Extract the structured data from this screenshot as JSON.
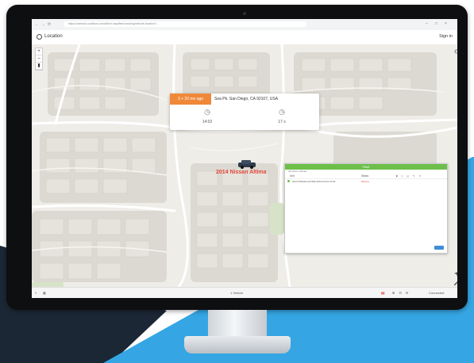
{
  "browser": {
    "back": "←",
    "forward": "→",
    "reload": "⟳",
    "url": "https://cartrack-solutions.com/#/live-map/fleet-tracking/vehicle-location?...",
    "controls": [
      "–",
      "□",
      "×"
    ]
  },
  "app": {
    "title": "Location",
    "signin": "Sign in"
  },
  "map_controls": [
    "+",
    "–",
    "▮"
  ],
  "popup": {
    "time_badge": "3 + 20 mo ago",
    "address": "Sea Pk. San Diego, CA 92107, USA",
    "stats": [
      {
        "icon": "clock-icon",
        "glyph": "◷",
        "value": "14:02"
      },
      {
        "icon": "timer-icon",
        "glyph": "◷",
        "value": "17 s"
      }
    ]
  },
  "vehicle_label": "2014 Nissan Altima",
  "panel": {
    "header": "Fleet",
    "subtitle": "All active vehicles",
    "columns": [
      "Unit",
      "Status"
    ],
    "row": {
      "unit": "2014 NISSAN ALTIMA 2014-04-01 14:02",
      "status": "Moving"
    }
  },
  "bottom_bar": {
    "center": "1 Vehicle",
    "right": "Connected"
  },
  "colors": {
    "accent_orange": "#f0883a",
    "vehicle_red": "#e5473a",
    "panel_green": "#6dbf4a",
    "background_dark": "#1c2735",
    "background_blue": "#35a6e3"
  }
}
